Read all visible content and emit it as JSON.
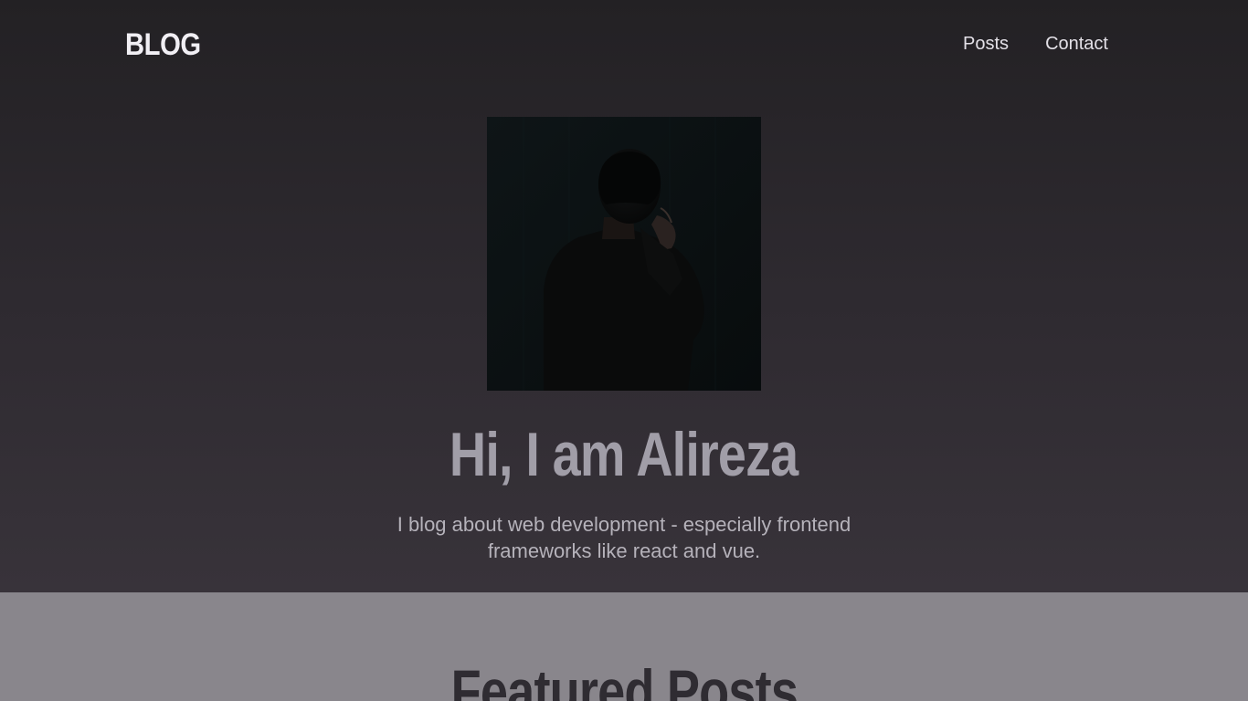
{
  "header": {
    "logo": "BLOG",
    "nav": [
      {
        "label": "Posts"
      },
      {
        "label": "Contact"
      }
    ]
  },
  "hero": {
    "image_alt": "Alireza",
    "title": "Hi, I am Alireza",
    "description": "I blog about web development - especially frontend frameworks like react and vue."
  },
  "featured": {
    "title": "Featured Posts"
  },
  "colors": {
    "hero_bg_top": "#232124",
    "hero_bg_bottom": "#38333a",
    "featured_bg": "#89868c",
    "title_text": "#a19ea8"
  }
}
